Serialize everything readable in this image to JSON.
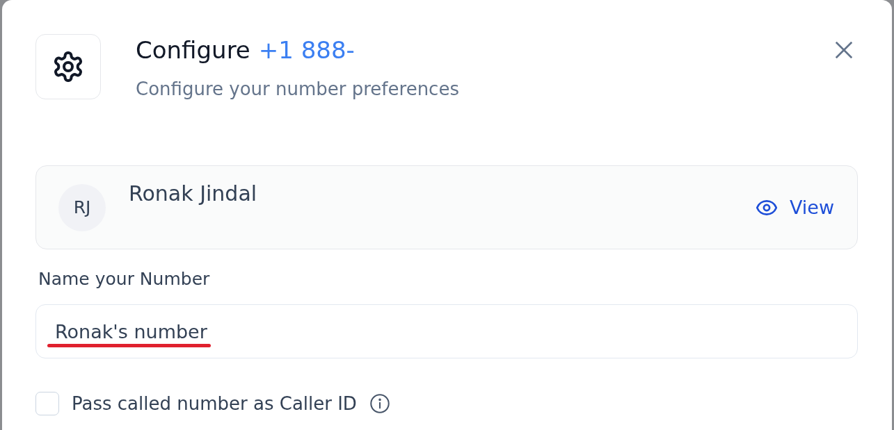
{
  "dialog": {
    "title": "Configure",
    "number": "+1 888-",
    "subtitle": "Configure your number preferences"
  },
  "user_card": {
    "initials": "RJ",
    "name": "Ronak Jindal",
    "action": "View"
  },
  "name_field": {
    "label": "Name your Number",
    "value": "Ronak's number",
    "spellcheck_error": true
  },
  "caller_id_option": {
    "label": "Pass called number as Caller ID",
    "checked": false
  }
}
